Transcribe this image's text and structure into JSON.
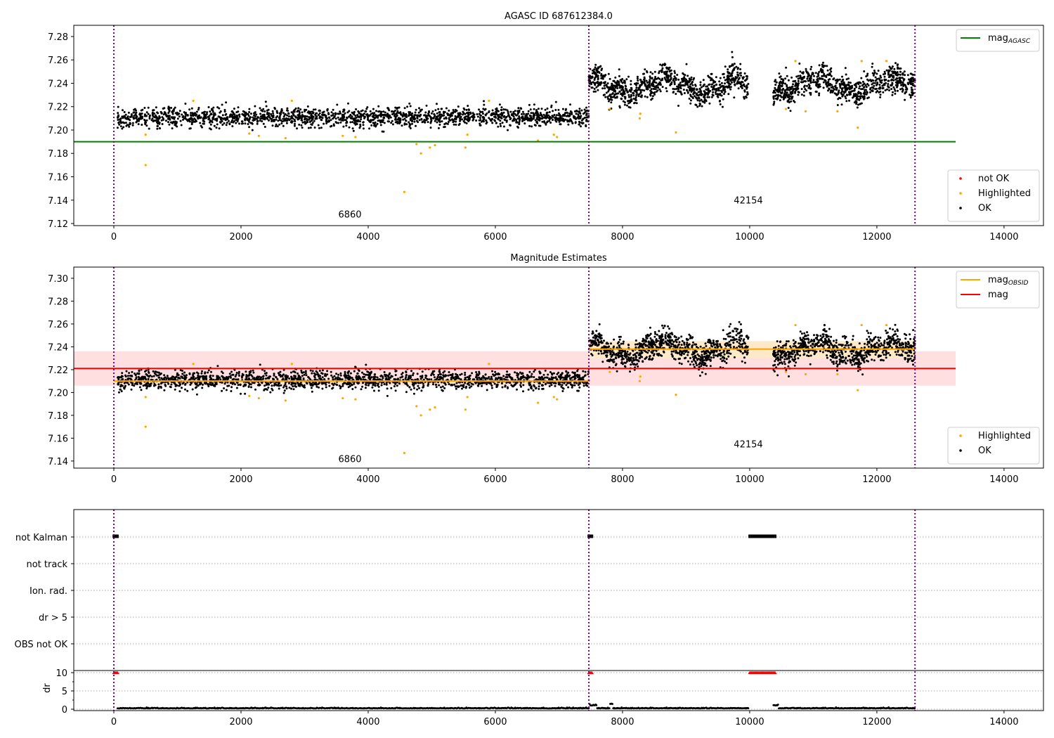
{
  "chart_data": [
    {
      "type": "scatter",
      "title": "AGASC ID 687612384.0",
      "xlim": [
        -630,
        14620
      ],
      "ylim": [
        7.1182,
        7.2896
      ],
      "xticks": [
        0,
        2000,
        4000,
        6000,
        8000,
        10000,
        12000,
        14000
      ],
      "yticks": [
        7.12,
        7.14,
        7.16,
        7.18,
        7.2,
        7.22,
        7.24,
        7.26,
        7.28
      ],
      "vlines": [
        0,
        7470,
        12600
      ],
      "hline": {
        "label": "mag",
        "sub": "AGASC",
        "value": 7.19,
        "xmax": 13240,
        "color": "#008000"
      },
      "legend_top": [
        {
          "label": "mag",
          "sub": "AGASC",
          "color": "#008000"
        }
      ],
      "legend_bottom": [
        {
          "label": "not OK",
          "color": "#ff0000"
        },
        {
          "label": "Highlighted",
          "color": "#ffa500"
        },
        {
          "label": "OK",
          "color": "#000000"
        }
      ],
      "annotations": [
        {
          "text": "6860",
          "x": 3530,
          "y": 7.125
        },
        {
          "text": "42154",
          "x": 9750,
          "y": 7.137
        }
      ],
      "segments": [
        {
          "x": [
            60,
            7470
          ],
          "mean": 7.211,
          "sd": 0.004
        },
        {
          "x": [
            7470,
            12600
          ],
          "mean": 7.238,
          "sd": 0.006,
          "gap": [
            9980,
            10370
          ]
        }
      ],
      "highlighted": [
        [
          500,
          7.196
        ],
        [
          500,
          7.17
        ],
        [
          1250,
          7.225
        ],
        [
          2130,
          7.197
        ],
        [
          2280,
          7.195
        ],
        [
          2700,
          7.193
        ],
        [
          2800,
          7.225
        ],
        [
          3600,
          7.195
        ],
        [
          3800,
          7.194
        ],
        [
          4570,
          7.147
        ],
        [
          4760,
          7.188
        ],
        [
          4830,
          7.18
        ],
        [
          4970,
          7.185
        ],
        [
          5050,
          7.187
        ],
        [
          5530,
          7.185
        ],
        [
          5560,
          7.196
        ],
        [
          5900,
          7.225
        ],
        [
          6670,
          7.191
        ],
        [
          6920,
          7.196
        ],
        [
          6970,
          7.194
        ],
        [
          7800,
          7.218
        ],
        [
          8270,
          7.21
        ],
        [
          8280,
          7.214
        ],
        [
          8840,
          7.198
        ],
        [
          10570,
          7.218
        ],
        [
          10720,
          7.259
        ],
        [
          10880,
          7.216
        ],
        [
          11380,
          7.216
        ],
        [
          11700,
          7.202
        ],
        [
          11760,
          7.259
        ],
        [
          12150,
          7.259
        ]
      ]
    },
    {
      "type": "scatter",
      "title": "Magnitude Estimates",
      "xlim": [
        -630,
        14620
      ],
      "ylim": [
        7.1338,
        7.3098
      ],
      "xticks": [
        0,
        2000,
        4000,
        6000,
        8000,
        10000,
        12000,
        14000
      ],
      "yticks": [
        7.14,
        7.16,
        7.18,
        7.2,
        7.22,
        7.24,
        7.26,
        7.28,
        7.3
      ],
      "vlines": [
        0,
        7470,
        12600
      ],
      "mag_line": {
        "value": 7.221,
        "band": [
          7.206,
          7.236
        ],
        "xmax": 13240,
        "color": "#ff0000"
      },
      "obsid_lines": [
        {
          "x": [
            0,
            7470
          ],
          "value": 7.21,
          "band": [
            7.208,
            7.212
          ]
        },
        {
          "x": [
            7470,
            12600
          ],
          "value": 7.238,
          "band": [
            7.23,
            7.245
          ]
        }
      ],
      "legend_top": [
        {
          "label": "mag",
          "sub": "OBSID",
          "color": "#ffa500"
        },
        {
          "label": "mag",
          "sub": "",
          "color": "#ff0000"
        }
      ],
      "legend_bottom": [
        {
          "label": "Highlighted",
          "color": "#ffa500"
        },
        {
          "label": "OK",
          "color": "#000000"
        }
      ],
      "annotations": [
        {
          "text": "6860",
          "x": 3530,
          "y": 7.139
        },
        {
          "text": "42154",
          "x": 9750,
          "y": 7.152
        }
      ]
    },
    {
      "type": "scatter",
      "title": "",
      "categories": [
        "not Kalman",
        "not track",
        "Ion. rad.",
        "dr > 5",
        "OBS not OK"
      ],
      "flags": {
        "not Kalman": [
          [
            0,
            60
          ],
          [
            7470,
            7520
          ],
          [
            10000,
            10400
          ]
        ]
      },
      "dr": {
        "ylabel": "dr",
        "yticks": [
          0,
          5,
          10
        ],
        "ylim": [
          -0.38,
          10.58
        ],
        "high_ranges": [
          [
            0,
            60
          ],
          [
            7470,
            7520
          ],
          [
            10000,
            10400
          ]
        ],
        "high_value": 10,
        "baseline": 0.2
      },
      "xticks": [
        0,
        2000,
        4000,
        6000,
        8000,
        10000,
        12000,
        14000
      ]
    }
  ]
}
